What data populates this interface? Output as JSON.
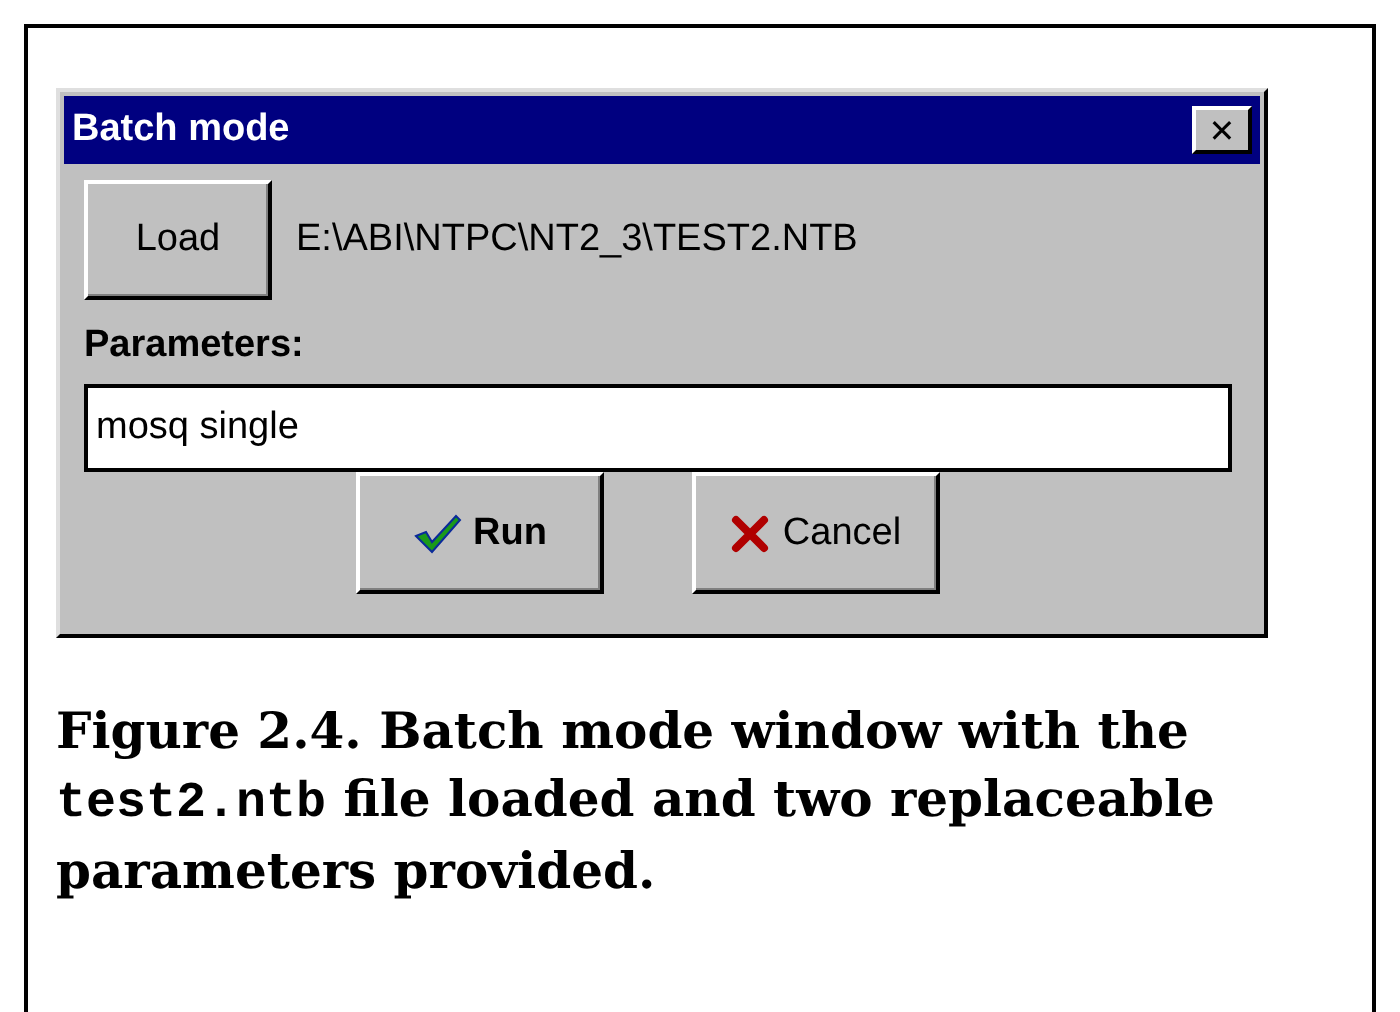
{
  "window": {
    "title": "Batch mode",
    "close_glyph": "✕"
  },
  "load_button": {
    "label": "Load"
  },
  "file_path": "E:\\ABI\\NTPC\\NT2_3\\TEST2.NTB",
  "parameters": {
    "label": "Parameters:",
    "value": "mosq single"
  },
  "buttons": [
    {
      "label": "Run",
      "kind": "run"
    },
    {
      "label": "Cancel",
      "kind": "cancel"
    }
  ],
  "caption": [
    {
      "kind": "text",
      "text": "Figure 2.4.  Batch mode window with the "
    },
    {
      "kind": "code",
      "text": "test2.ntb"
    },
    {
      "kind": "text",
      "text": " file loaded and two replaceable parameters provided."
    }
  ]
}
